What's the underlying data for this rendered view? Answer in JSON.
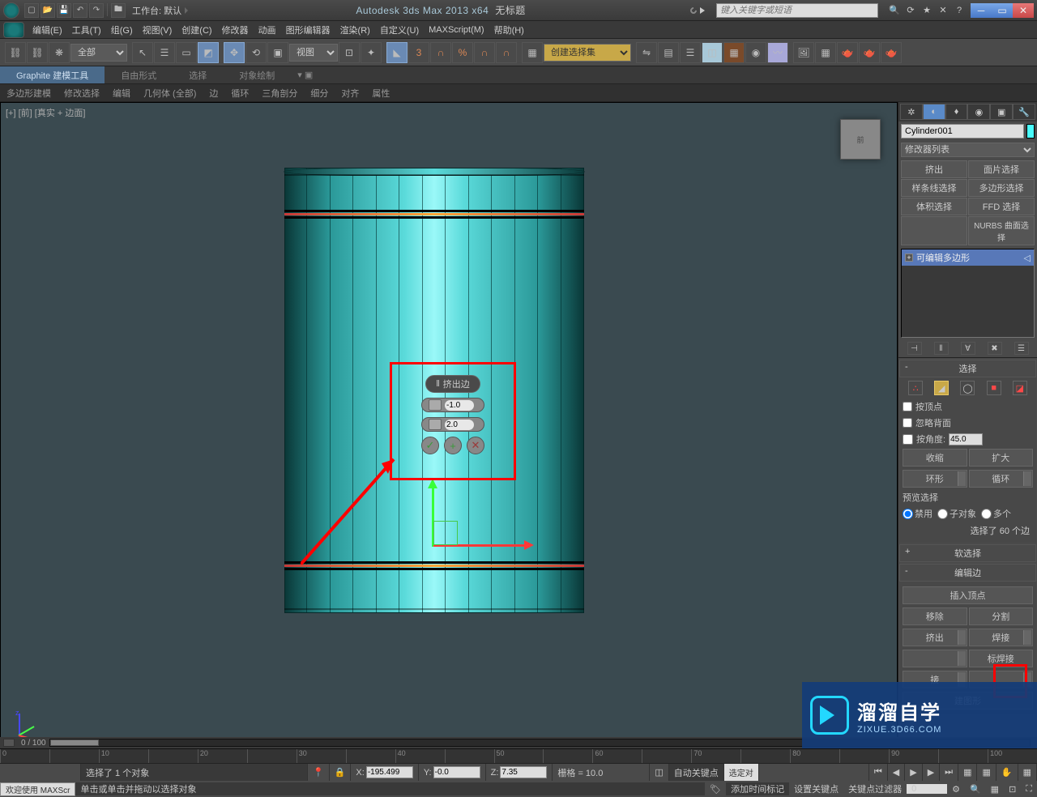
{
  "title": {
    "app": "Autodesk 3ds Max  2013 x64",
    "doc": "无标题",
    "workspace_label": "工作台: 默认",
    "search_placeholder": "键入关键字或短语"
  },
  "menus": [
    "编辑(E)",
    "工具(T)",
    "组(G)",
    "视图(V)",
    "创建(C)",
    "修改器",
    "动画",
    "图形编辑器",
    "渲染(R)",
    "自定义(U)",
    "MAXScript(M)",
    "帮助(H)"
  ],
  "toolbar": {
    "filter": "全部",
    "refcoord": "视图"
  },
  "selection_set_placeholder": "创建选择集",
  "ribbon": {
    "tabs": [
      "Graphite 建模工具",
      "自由形式",
      "选择",
      "对象绘制"
    ],
    "sub": [
      "多边形建模",
      "修改选择",
      "编辑",
      "几何体 (全部)",
      "边",
      "循环",
      "三角剖分",
      "细分",
      "对齐",
      "属性"
    ]
  },
  "viewport": {
    "label": "[+] [前] [真实 + 边面]",
    "cube": "前"
  },
  "caddy": {
    "title": "挤出边",
    "height": "-1.0",
    "width": "2.0"
  },
  "panel": {
    "object_name": "Cylinder001",
    "modifier_list": "修改器列表",
    "mod_buttons": [
      "挤出",
      "面片选择",
      "样条线选择",
      "多边形选择",
      "体积选择",
      "FFD 选择",
      "",
      "NURBS 曲面选择"
    ],
    "stack_item": "可编辑多边形",
    "selection": {
      "hdr": "选择",
      "by_vertex": "按顶点",
      "ignore_back": "忽略背面",
      "by_angle": "按角度:",
      "angle_val": "45.0",
      "shrink": "收缩",
      "grow": "扩大",
      "ring": "环形",
      "loop": "循环",
      "preview": "预览选择",
      "off": "禁用",
      "subobj": "子对象",
      "multi": "多个",
      "count": "选择了 60 个边"
    },
    "soft_hdr": "软选择",
    "edit_edge": {
      "hdr": "编辑边",
      "insert_vertex": "插入顶点",
      "remove": "移除",
      "split": "分割",
      "extrude": "挤出",
      "weld": "焊接",
      "target_weld": "标焊接",
      "bridge": "接",
      "create_shape": "建图形"
    }
  },
  "timeline": {
    "frame": "0 / 100",
    "ticks": [
      "0",
      "10",
      "20",
      "30",
      "40",
      "50",
      "60",
      "70",
      "80",
      "90",
      "100"
    ]
  },
  "status": {
    "sel": "选择了 1 个对象",
    "x": "-195.499",
    "y": "-0.0",
    "z": "7.35",
    "grid": "栅格 = 10.0",
    "autokey": "自动关键点",
    "selected": "选定对",
    "prompt": "单击或单击并拖动以选择对象",
    "welcome": "欢迎使用  MAXScr",
    "add_time": "添加时间标记",
    "set_key": "设置关键点",
    "key_filter": "关键点过滤器"
  },
  "watermark": {
    "big": "溜溜自学",
    "small": "ZIXUE.3D66.COM"
  }
}
